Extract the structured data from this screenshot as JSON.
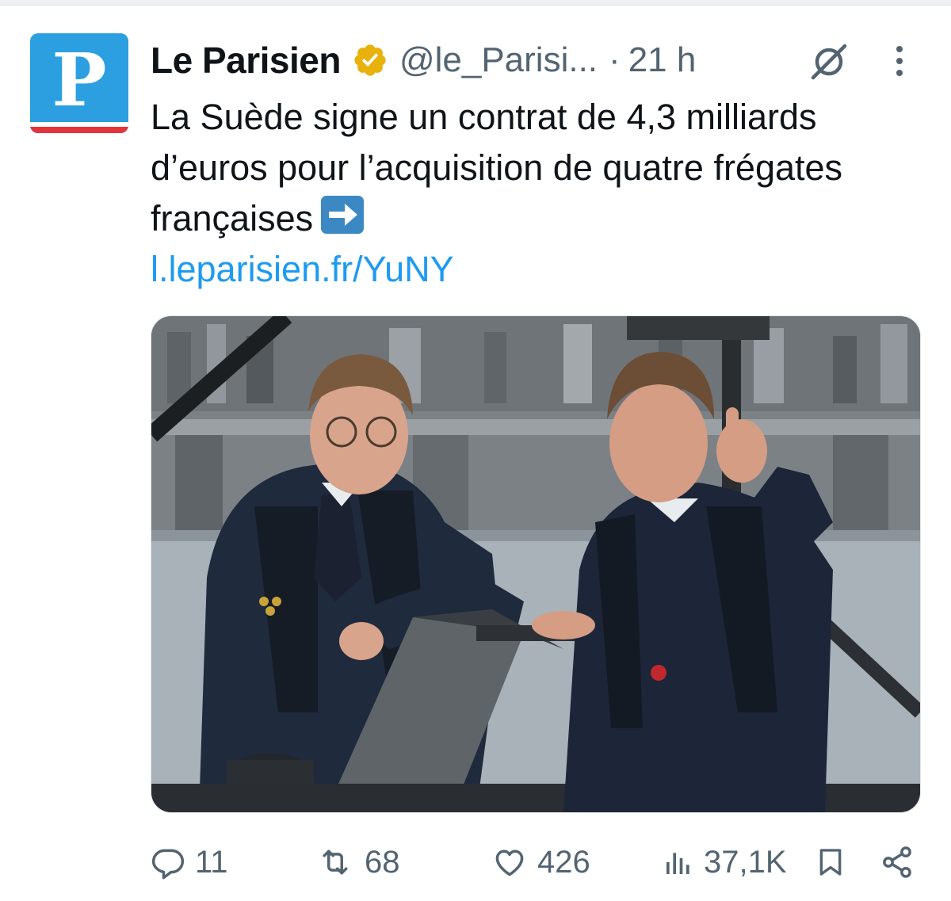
{
  "account": {
    "avatar_letter": "P",
    "display_name": "Le Parisien",
    "handle": "@le_Parisi...",
    "separator": "·",
    "time": "21 h",
    "brand_color": "#2b9fe0",
    "accent_red": "#e2343b",
    "verified_color": "#e8b10b"
  },
  "tweet": {
    "text": "La Suède signe un contrat de 4,3 milliards d’euros pour l’acquisition de quatre frégates françaises",
    "emoji": "arrow-right-emoji",
    "link": "l.leparisien.fr/YuNY",
    "link_color": "#1d9bf0"
  },
  "media": {
    "icon": "photo"
  },
  "actions": {
    "replies": "11",
    "retweets": "68",
    "likes": "426",
    "views": "37,1K"
  },
  "icons": {
    "grok": "grok-icon",
    "more": "more-icon",
    "reply": "reply-icon",
    "retweet": "retweet-icon",
    "like": "heart-icon",
    "views": "views-icon",
    "bookmark": "bookmark-icon",
    "share": "share-icon"
  }
}
